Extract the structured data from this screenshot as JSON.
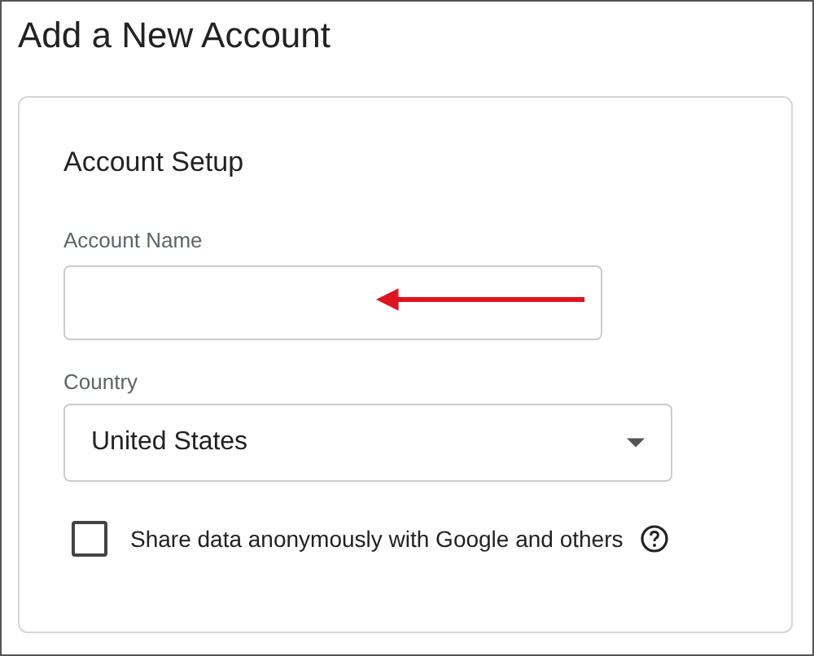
{
  "page": {
    "title": "Add a New Account"
  },
  "card": {
    "heading": "Account Setup",
    "account_name": {
      "label": "Account Name"
    },
    "country": {
      "label": "Country",
      "value": "United States"
    },
    "share_data": {
      "label": "Share data anonymously with Google and others",
      "checked": false
    }
  }
}
